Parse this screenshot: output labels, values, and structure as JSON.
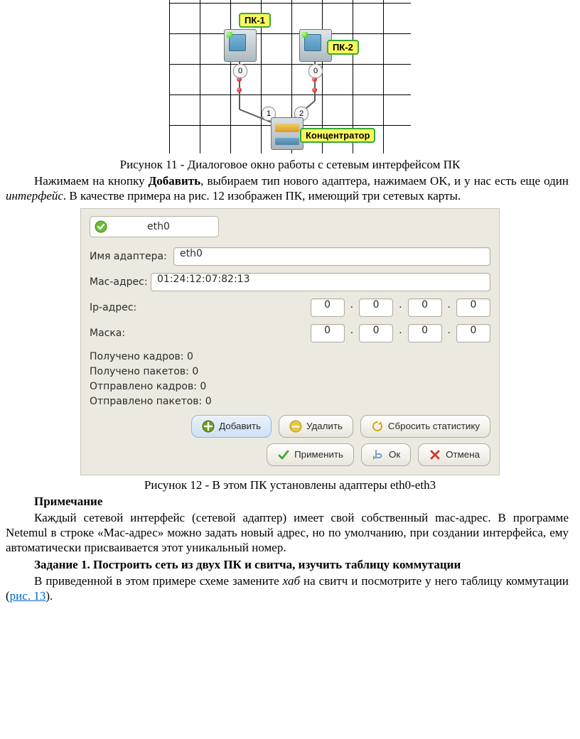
{
  "fig11": {
    "pc1_tag": "ПК-1",
    "pc2_tag": "ПК-2",
    "hub_tag": "Концентратор",
    "port0_a": "0",
    "port0_b": "0",
    "port1": "1",
    "port2": "2",
    "caption": "Рисунок 11 - Диалоговое окно работы с сетевым интерфейсом ПК"
  },
  "text": {
    "p1_a": "Нажимаем на кнопку ",
    "p1_b": "Добавить",
    "p1_c": ", выбираем тип нового адаптера, нажимаем OK, и у нас есть еще один ",
    "p1_d": "интерфейс",
    "p1_e": ". В качестве примера на рис. 12 изображен ПК, имеющий три сетевых карты.",
    "fig12_caption": "Рисунок 12 - В этом ПК установлены адаптеры eth0-eth3",
    "note_head": "Примечание",
    "note_body": "Каждый сетевой интерфейс (сетевой адаптер) имеет свой собственный mac-адрес. В программе Netemul в строке «Mac-адрес» можно задать новый адрес, но по умолчанию, при создании интерфейса, ему автоматически присваивается этот уникальный номер.",
    "task_head": "Задание 1. Построить сеть из двух ПК и свитча, изучить таблицу коммутации",
    "task_a": "В приведенной в этом примере схеме замените ",
    "task_b": "хаб",
    "task_c": " на свитч и посмотрите у него таблицу коммутации (",
    "task_link": "рис. 13",
    "task_d": ")."
  },
  "dialog": {
    "tab": "eth0",
    "adapter_label": "Имя адаптера:",
    "adapter_value": "eth0",
    "mac_label": "Mac-адрес:",
    "mac_value": "01:24:12:07:82:13",
    "ip_label": "Ip-адрес:",
    "ip": [
      "0",
      "0",
      "0",
      "0"
    ],
    "mask_label": "Маска:",
    "mask": [
      "0",
      "0",
      "0",
      "0"
    ],
    "dot": "·",
    "stats": {
      "l1": "Получено кадров: 0",
      "l2": "Получено пакетов: 0",
      "l3": "Отправлено кадров: 0",
      "l4": "Отправлено пакетов: 0"
    },
    "btn": {
      "add": "Добавить",
      "del": "Удалить",
      "reset": "Сбросить статистику",
      "apply": "Применить",
      "ok": "Ок",
      "cancel": "Отмена"
    }
  }
}
